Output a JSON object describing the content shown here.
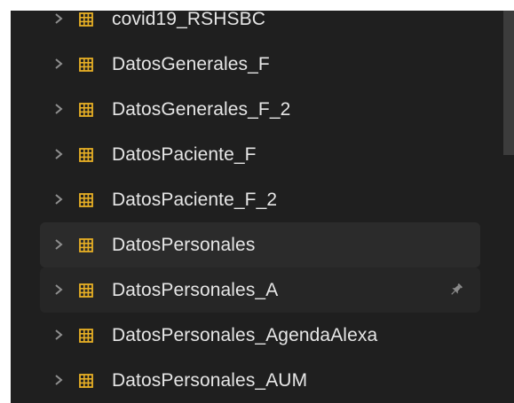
{
  "colors": {
    "panel_bg": "#1f1f1f",
    "hover_row_bg": "#2b2b2b",
    "selected_row_bg": "#262626",
    "text": "#e6e6e6",
    "chevron": "#8f8f8f",
    "table_icon": "#e8b025",
    "pin": "#8a8a8a",
    "scrollbar_thumb": "#3c3c3c"
  },
  "icons": {
    "expand": "chevron-right-icon",
    "table": "table-icon",
    "pin": "pin-icon"
  },
  "tables": [
    {
      "label": "covid19_RSHSBC"
    },
    {
      "label": "DatosGenerales_F"
    },
    {
      "label": "DatosGenerales_F_2"
    },
    {
      "label": "DatosPaciente_F"
    },
    {
      "label": "DatosPaciente_F_2"
    },
    {
      "label": "DatosPersonales"
    },
    {
      "label": "DatosPersonales_A"
    },
    {
      "label": "DatosPersonales_AgendaAlexa"
    },
    {
      "label": "DatosPersonales_AUM"
    }
  ]
}
